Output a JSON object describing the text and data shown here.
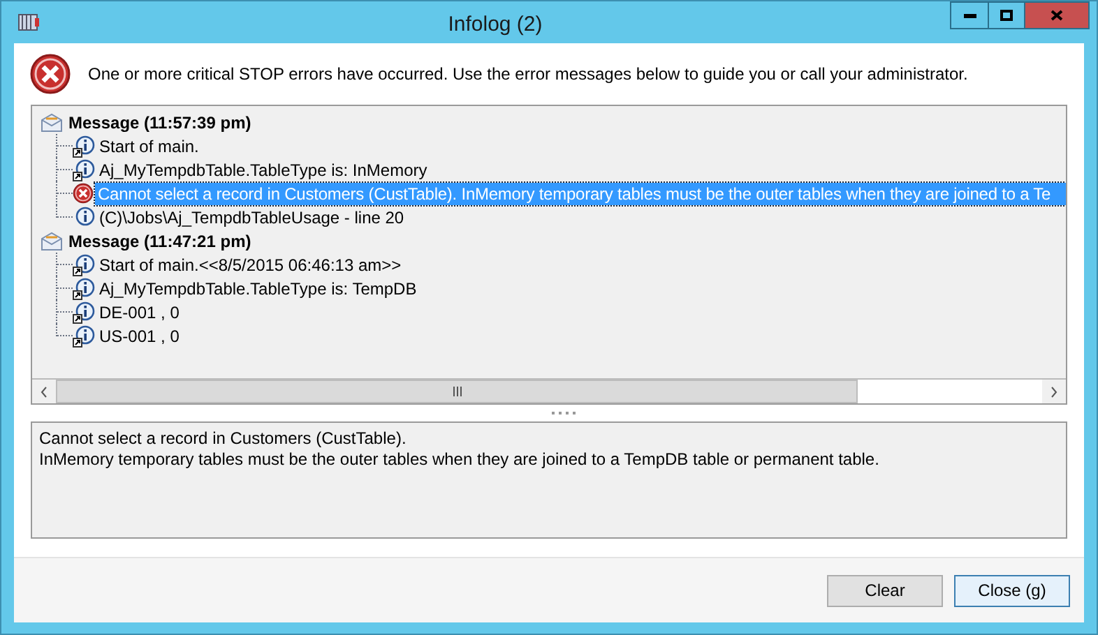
{
  "window": {
    "title": "Infolog (2)"
  },
  "header": {
    "text": "One or more critical STOP errors have occurred. Use the error messages below to guide you or call your administrator."
  },
  "groups": [
    {
      "title": "Message (11:57:39 pm)",
      "children": [
        {
          "kind": "info_link",
          "text": "Start of main.",
          "selected": false
        },
        {
          "kind": "info_link",
          "text": "Aj_MyTempdbTable.TableType is: InMemory",
          "selected": false
        },
        {
          "kind": "error",
          "text": "Cannot select a record in Customers (CustTable). InMemory temporary tables must be the outer tables when they are joined to a Te",
          "selected": true
        },
        {
          "kind": "info",
          "text": "(C)\\Jobs\\Aj_TempdbTableUsage - line 20",
          "selected": false
        }
      ]
    },
    {
      "title": "Message (11:47:21 pm)",
      "children": [
        {
          "kind": "info_link",
          "text": "Start of main.<<8/5/2015 06:46:13 am>>",
          "selected": false
        },
        {
          "kind": "info_link",
          "text": "Aj_MyTempdbTable.TableType is: TempDB",
          "selected": false
        },
        {
          "kind": "info_link",
          "text": "DE-001 , 0",
          "selected": false
        },
        {
          "kind": "info_link",
          "text": "US-001 , 0",
          "selected": false
        }
      ]
    }
  ],
  "detail": [
    "Cannot select a record in Customers (CustTable).",
    "InMemory temporary tables must be the outer tables when they are joined to a TempDB table or permanent table."
  ],
  "buttons": [
    {
      "label": "Clear",
      "kind": "normal"
    },
    {
      "label": "Close (g)",
      "kind": "default"
    }
  ]
}
